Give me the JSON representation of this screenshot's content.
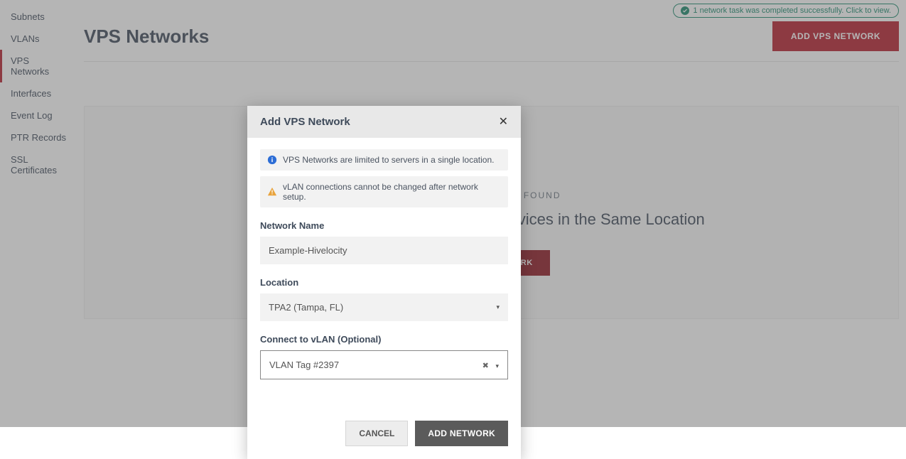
{
  "sidebar": {
    "items": [
      {
        "label": "Subnets"
      },
      {
        "label": "VLANs"
      },
      {
        "label": "VPS Networks"
      },
      {
        "label": "Interfaces"
      },
      {
        "label": "Event Log"
      },
      {
        "label": "PTR Records"
      },
      {
        "label": "SSL Certificates"
      }
    ],
    "active_index": 2
  },
  "notification": {
    "text": "1 network task was completed successfully. Click to view."
  },
  "page": {
    "title": "VPS Networks",
    "add_button": "ADD VPS NETWORK"
  },
  "empty_state": {
    "subheading": "NO VPS NETWORK FOUND",
    "heading": "Create a Network for Your VPS Devices in the Same Location",
    "button": "ADD VPS NETWORK"
  },
  "modal": {
    "title": "Add VPS Network",
    "info_banner": "VPS Networks are limited to servers in a single location.",
    "warn_banner": "vLAN connections cannot be changed after network setup.",
    "network_name_label": "Network Name",
    "network_name_value": "Example-Hivelocity",
    "location_label": "Location",
    "location_value": "TPA2 (Tampa, FL)",
    "vlan_label": "Connect to vLAN (Optional)",
    "vlan_value": "VLAN Tag #2397",
    "cancel": "CANCEL",
    "submit": "ADD NETWORK"
  }
}
